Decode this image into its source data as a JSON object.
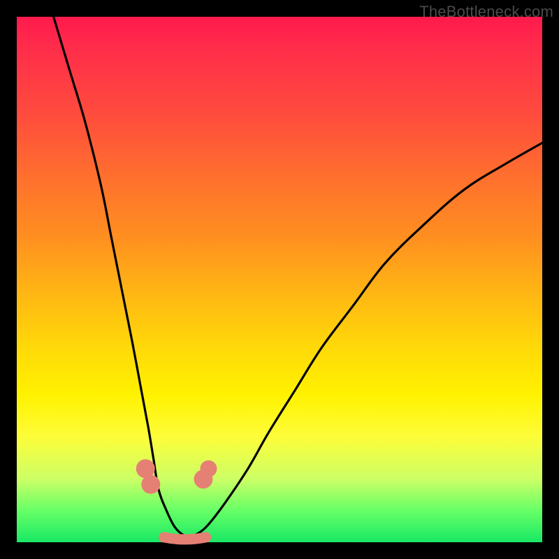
{
  "watermark": "TheBottleneck.com",
  "chart_data": {
    "type": "line",
    "title": "",
    "xlabel": "",
    "ylabel": "",
    "xlim": [
      0,
      100
    ],
    "ylim": [
      0,
      100
    ],
    "legend": false,
    "grid": false,
    "series": [
      {
        "name": "left-curve",
        "x": [
          7,
          10,
          13,
          16,
          18,
          20,
          22,
          23.5,
          25,
          26,
          27,
          28.5,
          30,
          31.5,
          33
        ],
        "values": [
          100,
          90,
          80,
          68,
          58,
          48,
          38,
          30,
          22,
          16,
          10,
          6,
          3,
          1.5,
          1
        ]
      },
      {
        "name": "right-curve",
        "x": [
          33,
          35,
          37,
          40,
          44,
          48,
          53,
          58,
          64,
          70,
          77,
          85,
          93,
          100
        ],
        "values": [
          1,
          2,
          4,
          8,
          14,
          21,
          29,
          37,
          45,
          53,
          60,
          67,
          72,
          76
        ]
      }
    ],
    "markers": [
      {
        "name": "left-dot-1",
        "x": 24.5,
        "y": 14,
        "r": 1.8
      },
      {
        "name": "left-dot-2",
        "x": 25.5,
        "y": 11,
        "r": 1.8
      },
      {
        "name": "right-dot-1",
        "x": 35.5,
        "y": 12,
        "r": 1.8
      },
      {
        "name": "right-dot-2",
        "x": 36.5,
        "y": 14,
        "r": 1.6
      }
    ],
    "valley_band": {
      "x_start": 28,
      "x_end": 36,
      "y": 1.2,
      "thickness": 2.2
    },
    "background_gradient": {
      "top": "#ff1a4d",
      "upper": "#ff8f20",
      "mid": "#fff200",
      "lower": "#ccff66",
      "bottom": "#19e865"
    },
    "curve_color": "#000000",
    "marker_color": "#e58074"
  }
}
